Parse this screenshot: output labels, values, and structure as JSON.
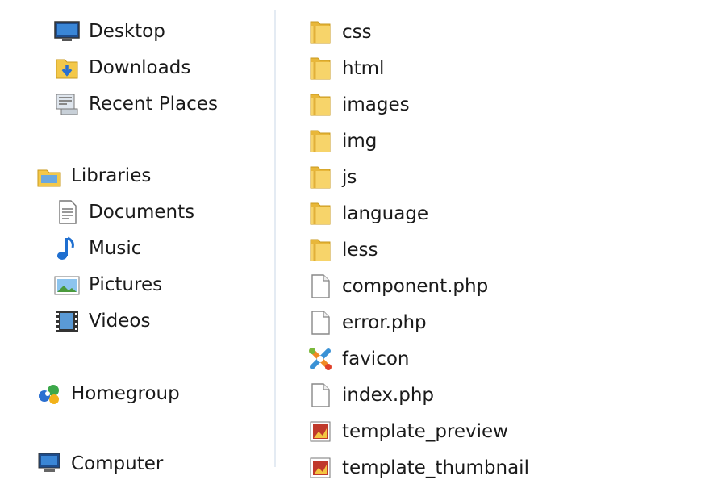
{
  "nav": {
    "favorites": [
      {
        "label": "Desktop",
        "icon": "desktop-icon"
      },
      {
        "label": "Downloads",
        "icon": "downloads-folder-icon"
      },
      {
        "label": "Recent Places",
        "icon": "recent-places-icon"
      }
    ],
    "libraries": {
      "label": "Libraries",
      "icon": "libraries-icon",
      "items": [
        {
          "label": "Documents",
          "icon": "documents-icon"
        },
        {
          "label": "Music",
          "icon": "music-icon"
        },
        {
          "label": "Pictures",
          "icon": "pictures-icon"
        },
        {
          "label": "Videos",
          "icon": "videos-icon"
        }
      ]
    },
    "homegroup": {
      "label": "Homegroup",
      "icon": "homegroup-icon"
    },
    "computer": {
      "label": "Computer",
      "icon": "computer-icon"
    }
  },
  "files": [
    {
      "name": "css",
      "type": "folder"
    },
    {
      "name": "html",
      "type": "folder"
    },
    {
      "name": "images",
      "type": "folder"
    },
    {
      "name": "img",
      "type": "folder"
    },
    {
      "name": "js",
      "type": "folder"
    },
    {
      "name": "language",
      "type": "folder"
    },
    {
      "name": "less",
      "type": "folder"
    },
    {
      "name": "component.php",
      "type": "file"
    },
    {
      "name": "error.php",
      "type": "file"
    },
    {
      "name": "favicon",
      "type": "favicon"
    },
    {
      "name": "index.php",
      "type": "file"
    },
    {
      "name": "template_preview",
      "type": "image"
    },
    {
      "name": "template_thumbnail",
      "type": "image"
    }
  ],
  "colors": {
    "folder": "#f3c84a",
    "selection_divider": "#e4ebf3",
    "text": "#1a1a1a"
  }
}
